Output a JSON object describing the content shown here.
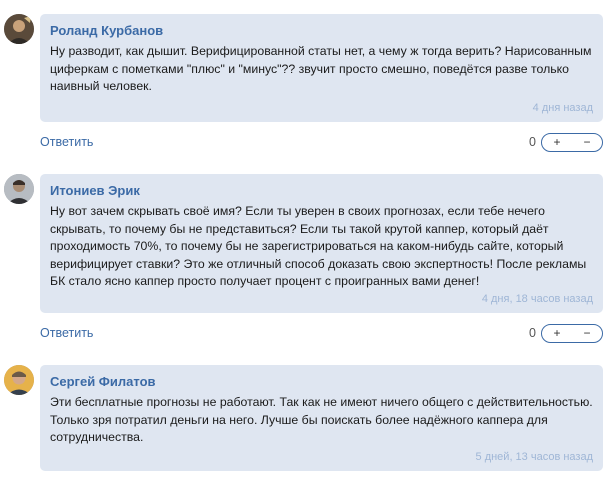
{
  "comments": [
    {
      "author": "Роланд Курбанов",
      "text": "Ну разводит, как дышит. Верифицированной статы нет, а чему ж тогда верить? Нарисованным циферкам с пометками \"плюс\" и \"минус\"?? звучит просто смешно, поведётся разве только наивный человек.",
      "time": "4 дня назад",
      "reply_label": "Ответить",
      "votes": "0",
      "plus": "+",
      "minus": "−"
    },
    {
      "author": "Итониев Эрик",
      "text": "Ну вот зачем скрывать своё имя? Если ты уверен в своих прогнозах, если тебе нечего скрывать, то почему бы не представиться? Если ты такой крутой каппер, который даёт проходимость 70%, то почему бы не зарегистрироваться на каком-нибудь сайте, который верифицирует ставки? Это же отличный способ доказать свою экспертность! После рекламы БК стало ясно каппер просто получает процент с проигранных вами денег!",
      "time": "4 дня, 18 часов назад",
      "reply_label": "Ответить",
      "votes": "0",
      "plus": "+",
      "minus": "−"
    },
    {
      "author": "Сергей Филатов",
      "text": "Эти бесплатные прогнозы не работают. Так как не имеют ничего общего с действительностью. Только зря потратил деньги на него. Лучше бы поискать более надёжного каппера для сотрудничества.",
      "time": "5 дней, 13 часов назад"
    }
  ]
}
